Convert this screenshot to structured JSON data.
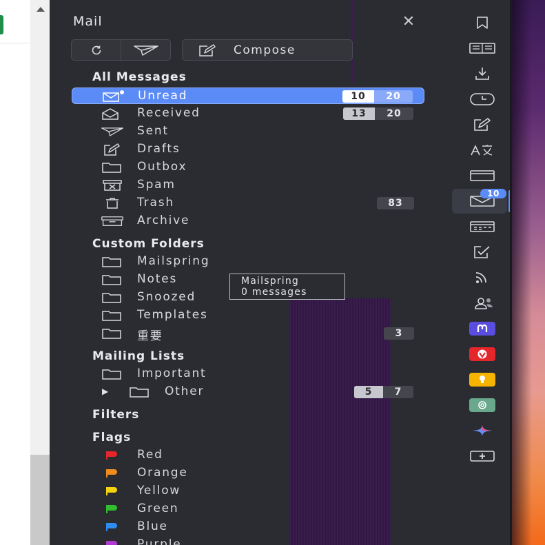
{
  "panel": {
    "title": "Mail",
    "compose_label": "Compose"
  },
  "sections": {
    "all_messages": "All Messages",
    "custom_folders": "Custom Folders",
    "mailing_lists": "Mailing Lists",
    "filters": "Filters",
    "flags": "Flags"
  },
  "all_messages": [
    {
      "label": "Unread",
      "unread": "10",
      "total": "20",
      "active": true
    },
    {
      "label": "Received",
      "unread": "13",
      "total": "20"
    },
    {
      "label": "Sent"
    },
    {
      "label": "Drafts"
    },
    {
      "label": "Outbox"
    },
    {
      "label": "Spam"
    },
    {
      "label": "Trash",
      "count": "83"
    },
    {
      "label": "Archive"
    }
  ],
  "custom_folders": [
    {
      "label": "Mailspring"
    },
    {
      "label": "Notes"
    },
    {
      "label": "Snoozed"
    },
    {
      "label": "Templates"
    },
    {
      "label": "重要",
      "count": "3"
    }
  ],
  "mailing_lists": [
    {
      "label": "Important"
    },
    {
      "label": "Other",
      "unread": "5",
      "total": "7"
    }
  ],
  "flags": [
    {
      "label": "Red",
      "color": "#e5262b"
    },
    {
      "label": "Orange",
      "color": "#f28c1e"
    },
    {
      "label": "Yellow",
      "color": "#f5d40f"
    },
    {
      "label": "Green",
      "color": "#2fbf2f"
    },
    {
      "label": "Blue",
      "color": "#2f8cf0"
    },
    {
      "label": "Purple",
      "color": "#b03ad0"
    }
  ],
  "tooltip": {
    "line1": "Mailspring",
    "line2": "0 messages"
  },
  "sidebar": {
    "mail_badge": "10",
    "accent": "#5b8bf7"
  }
}
